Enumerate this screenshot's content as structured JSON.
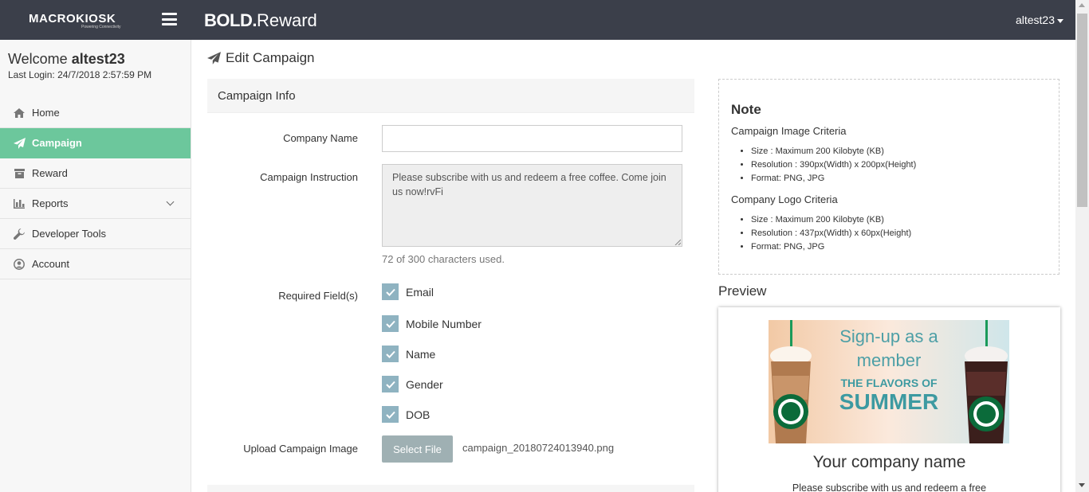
{
  "header": {
    "logo_text": "MACROKIOSK",
    "logo_tagline": "Powering Connectivity",
    "brand_bold": "BOLD.",
    "brand_light": "Reward",
    "user_menu_label": "altest23"
  },
  "sidebar": {
    "welcome_prefix": "Welcome",
    "username": "altest23",
    "last_login_label": "Last Login:",
    "last_login_value": "24/7/2018 2:57:59 PM",
    "items": [
      {
        "label": "Home",
        "icon": "home-icon"
      },
      {
        "label": "Campaign",
        "icon": "paper-plane-icon",
        "active": true
      },
      {
        "label": "Reward",
        "icon": "archive-icon"
      },
      {
        "label": "Reports",
        "icon": "bar-chart-icon",
        "has_submenu": true
      },
      {
        "label": "Developer Tools",
        "icon": "wrench-icon"
      },
      {
        "label": "Account",
        "icon": "user-circle-icon"
      }
    ],
    "active_color": "#6cc79c"
  },
  "page": {
    "title": "Edit Campaign",
    "section_title": "Campaign Info"
  },
  "form": {
    "company_name_label": "Company Name",
    "company_name_value": "",
    "instruction_label": "Campaign Instruction",
    "instruction_value": "Please subscribe with us and redeem a free coffee. Come join us now!rvFi",
    "char_count": "72 of 300 characters used.",
    "required_label": "Required Field(s)",
    "required_fields": [
      {
        "label": "Email",
        "checked": true
      },
      {
        "label": "Mobile Number",
        "checked": true
      },
      {
        "label": "Name",
        "checked": true
      },
      {
        "label": "Gender",
        "checked": true
      },
      {
        "label": "DOB",
        "checked": true
      }
    ],
    "upload_label": "Upload Campaign Image",
    "select_file_label": "Select File",
    "file_name": "campaign_20180724013940.png"
  },
  "note": {
    "title": "Note",
    "image_criteria_title": "Campaign Image Criteria",
    "image_size_label": "Size : Maximum ",
    "image_size_value": "200 Kilobyte (KB)",
    "image_res_label": "Resolution : ",
    "image_res_value": "390px(Width) x 200px(Height)",
    "image_format_label": "Format: ",
    "image_format_value": "PNG, JPG",
    "logo_criteria_title": "Company Logo Criteria",
    "logo_size_label": "Size : Maximum ",
    "logo_size_value": "200 Kilobyte (KB)",
    "logo_res_label": "Resolution : ",
    "logo_res_value": "437px(Width) x 60px(Height)",
    "logo_format_label": "Format: ",
    "logo_format_value": "PNG, JPG"
  },
  "preview": {
    "label": "Preview",
    "promo_line1": "Sign-up as a",
    "promo_line2": "member",
    "promo_line3": "THE FLAVORS OF",
    "promo_line4": "SUMMER",
    "company_name": "Your company name",
    "instruction": "Please subscribe with us and redeem a free"
  }
}
